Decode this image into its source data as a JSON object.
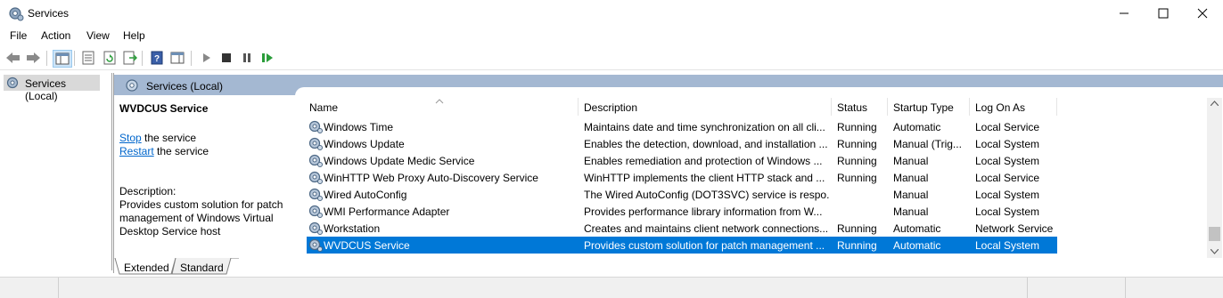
{
  "window": {
    "title": "Services"
  },
  "menu": [
    "File",
    "Action",
    "View",
    "Help"
  ],
  "tree": {
    "item_label": "Services (Local)"
  },
  "pane": {
    "header": "Services (Local)"
  },
  "detail": {
    "service_name": "WVDCUS Service",
    "stop_link": "Stop",
    "stop_suffix": " the service",
    "restart_link": "Restart",
    "restart_suffix": " the service",
    "description_label": "Description:",
    "description_line1": "Provides custom solution for patch",
    "description_line2": "management of Windows Virtual",
    "description_line3": "Desktop Service host"
  },
  "table": {
    "columns": [
      "Name",
      "Description",
      "Status",
      "Startup Type",
      "Log On As"
    ],
    "rows": [
      {
        "name": "Windows Time",
        "description": "Maintains date and time synchronization on all cli...",
        "status": "Running",
        "startup": "Automatic",
        "logon": "Local Service"
      },
      {
        "name": "Windows Update",
        "description": "Enables the detection, download, and installation ...",
        "status": "Running",
        "startup": "Manual (Trig...",
        "logon": "Local System"
      },
      {
        "name": "Windows Update Medic Service",
        "description": "Enables remediation and protection of Windows ...",
        "status": "Running",
        "startup": "Manual",
        "logon": "Local System"
      },
      {
        "name": "WinHTTP Web Proxy Auto-Discovery Service",
        "description": "WinHTTP implements the client HTTP stack and ...",
        "status": "Running",
        "startup": "Manual",
        "logon": "Local Service"
      },
      {
        "name": "Wired AutoConfig",
        "description": "The Wired AutoConfig (DOT3SVC) service is respo...",
        "status": "",
        "startup": "Manual",
        "logon": "Local System"
      },
      {
        "name": "WMI Performance Adapter",
        "description": "Provides performance library information from W...",
        "status": "",
        "startup": "Manual",
        "logon": "Local System"
      },
      {
        "name": "Workstation",
        "description": "Creates and maintains client network connections...",
        "status": "Running",
        "startup": "Automatic",
        "logon": "Network Service"
      },
      {
        "name": "WVDCUS Service",
        "description": "Provides custom solution for patch management ...",
        "status": "Running",
        "startup": "Automatic",
        "logon": "Local System"
      }
    ]
  },
  "tabs": [
    "Extended",
    "Standard"
  ],
  "colors": {
    "selection": "#0078d7",
    "pane_header": "#a4b8d2",
    "link": "#0066cc"
  }
}
